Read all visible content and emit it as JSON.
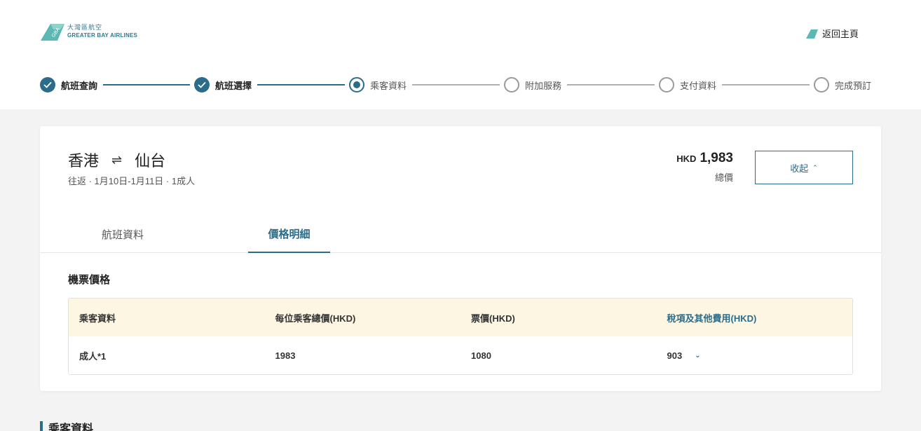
{
  "brand": {
    "name_cn": "大灣區航空",
    "name_en": "GREATER BAY AIRLINES"
  },
  "header": {
    "home_link": "返回主頁"
  },
  "stepper": {
    "steps": [
      {
        "label": "航班查詢",
        "state": "done"
      },
      {
        "label": "航班選擇",
        "state": "done"
      },
      {
        "label": "乘客資料",
        "state": "current"
      },
      {
        "label": "附加服務",
        "state": "todo"
      },
      {
        "label": "支付資料",
        "state": "todo"
      },
      {
        "label": "完成預訂",
        "state": "todo"
      }
    ]
  },
  "summary": {
    "origin": "香港",
    "swap_symbol": "⇌",
    "destination": "仙台",
    "trip_info": "往返 · 1月10日-1月11日 · 1成人",
    "currency": "HKD",
    "total_amount": "1,983",
    "total_label": "總價",
    "collapse_label": "收起"
  },
  "tabs": [
    {
      "label": "航班資料",
      "active": false
    },
    {
      "label": "價格明細",
      "active": true
    }
  ],
  "fare": {
    "section_title": "機票價格",
    "headers": [
      "乘客資料",
      "每位乘客總價(HKD)",
      "票價(HKD)",
      "稅項及其他費用(HKD)"
    ],
    "rows": [
      {
        "passenger": "成人*1",
        "total": "1983",
        "fare": "1080",
        "taxes": "903"
      }
    ]
  },
  "passenger_section": {
    "title": "乘客資料"
  },
  "colors": {
    "accent": "#2b6c8a",
    "header_row_bg": "#fdf6e3",
    "page_bg": "#f3f3f3"
  }
}
